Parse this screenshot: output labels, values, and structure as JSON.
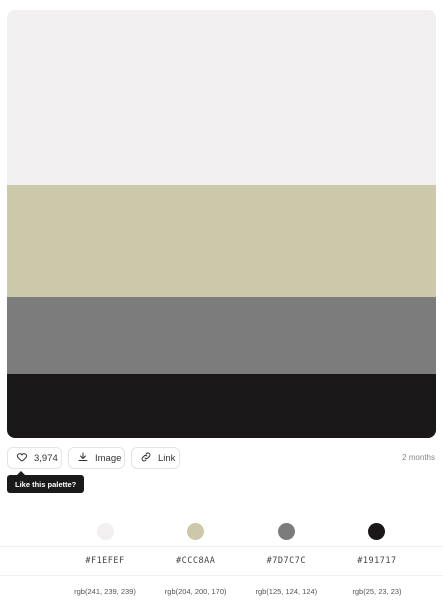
{
  "palette": {
    "colors": [
      {
        "hex": "#F1EFEF",
        "rgb": "rgb(241, 239, 239)",
        "swatch_color": "#f1efef",
        "height_share": 41
      },
      {
        "hex": "#CCC8AA",
        "rgb": "rgb(204, 200, 170)",
        "swatch_color": "#ccc8aa",
        "height_share": 26
      },
      {
        "hex": "#7D7C7C",
        "rgb": "rgb(125, 124, 124)",
        "swatch_color": "#7d7c7c",
        "height_share": 18
      },
      {
        "hex": "#191717",
        "rgb": "rgb(25, 23, 23)",
        "swatch_color": "#191717",
        "height_share": 15
      }
    ]
  },
  "actions": {
    "like": {
      "count": "3,974",
      "icon": "heart-icon"
    },
    "image": {
      "label": "Image",
      "icon": "download-icon"
    },
    "link": {
      "label": "Link",
      "icon": "link-icon"
    }
  },
  "meta": {
    "time_ago": "2 months"
  },
  "tooltip": {
    "text": "Like this palette?"
  }
}
